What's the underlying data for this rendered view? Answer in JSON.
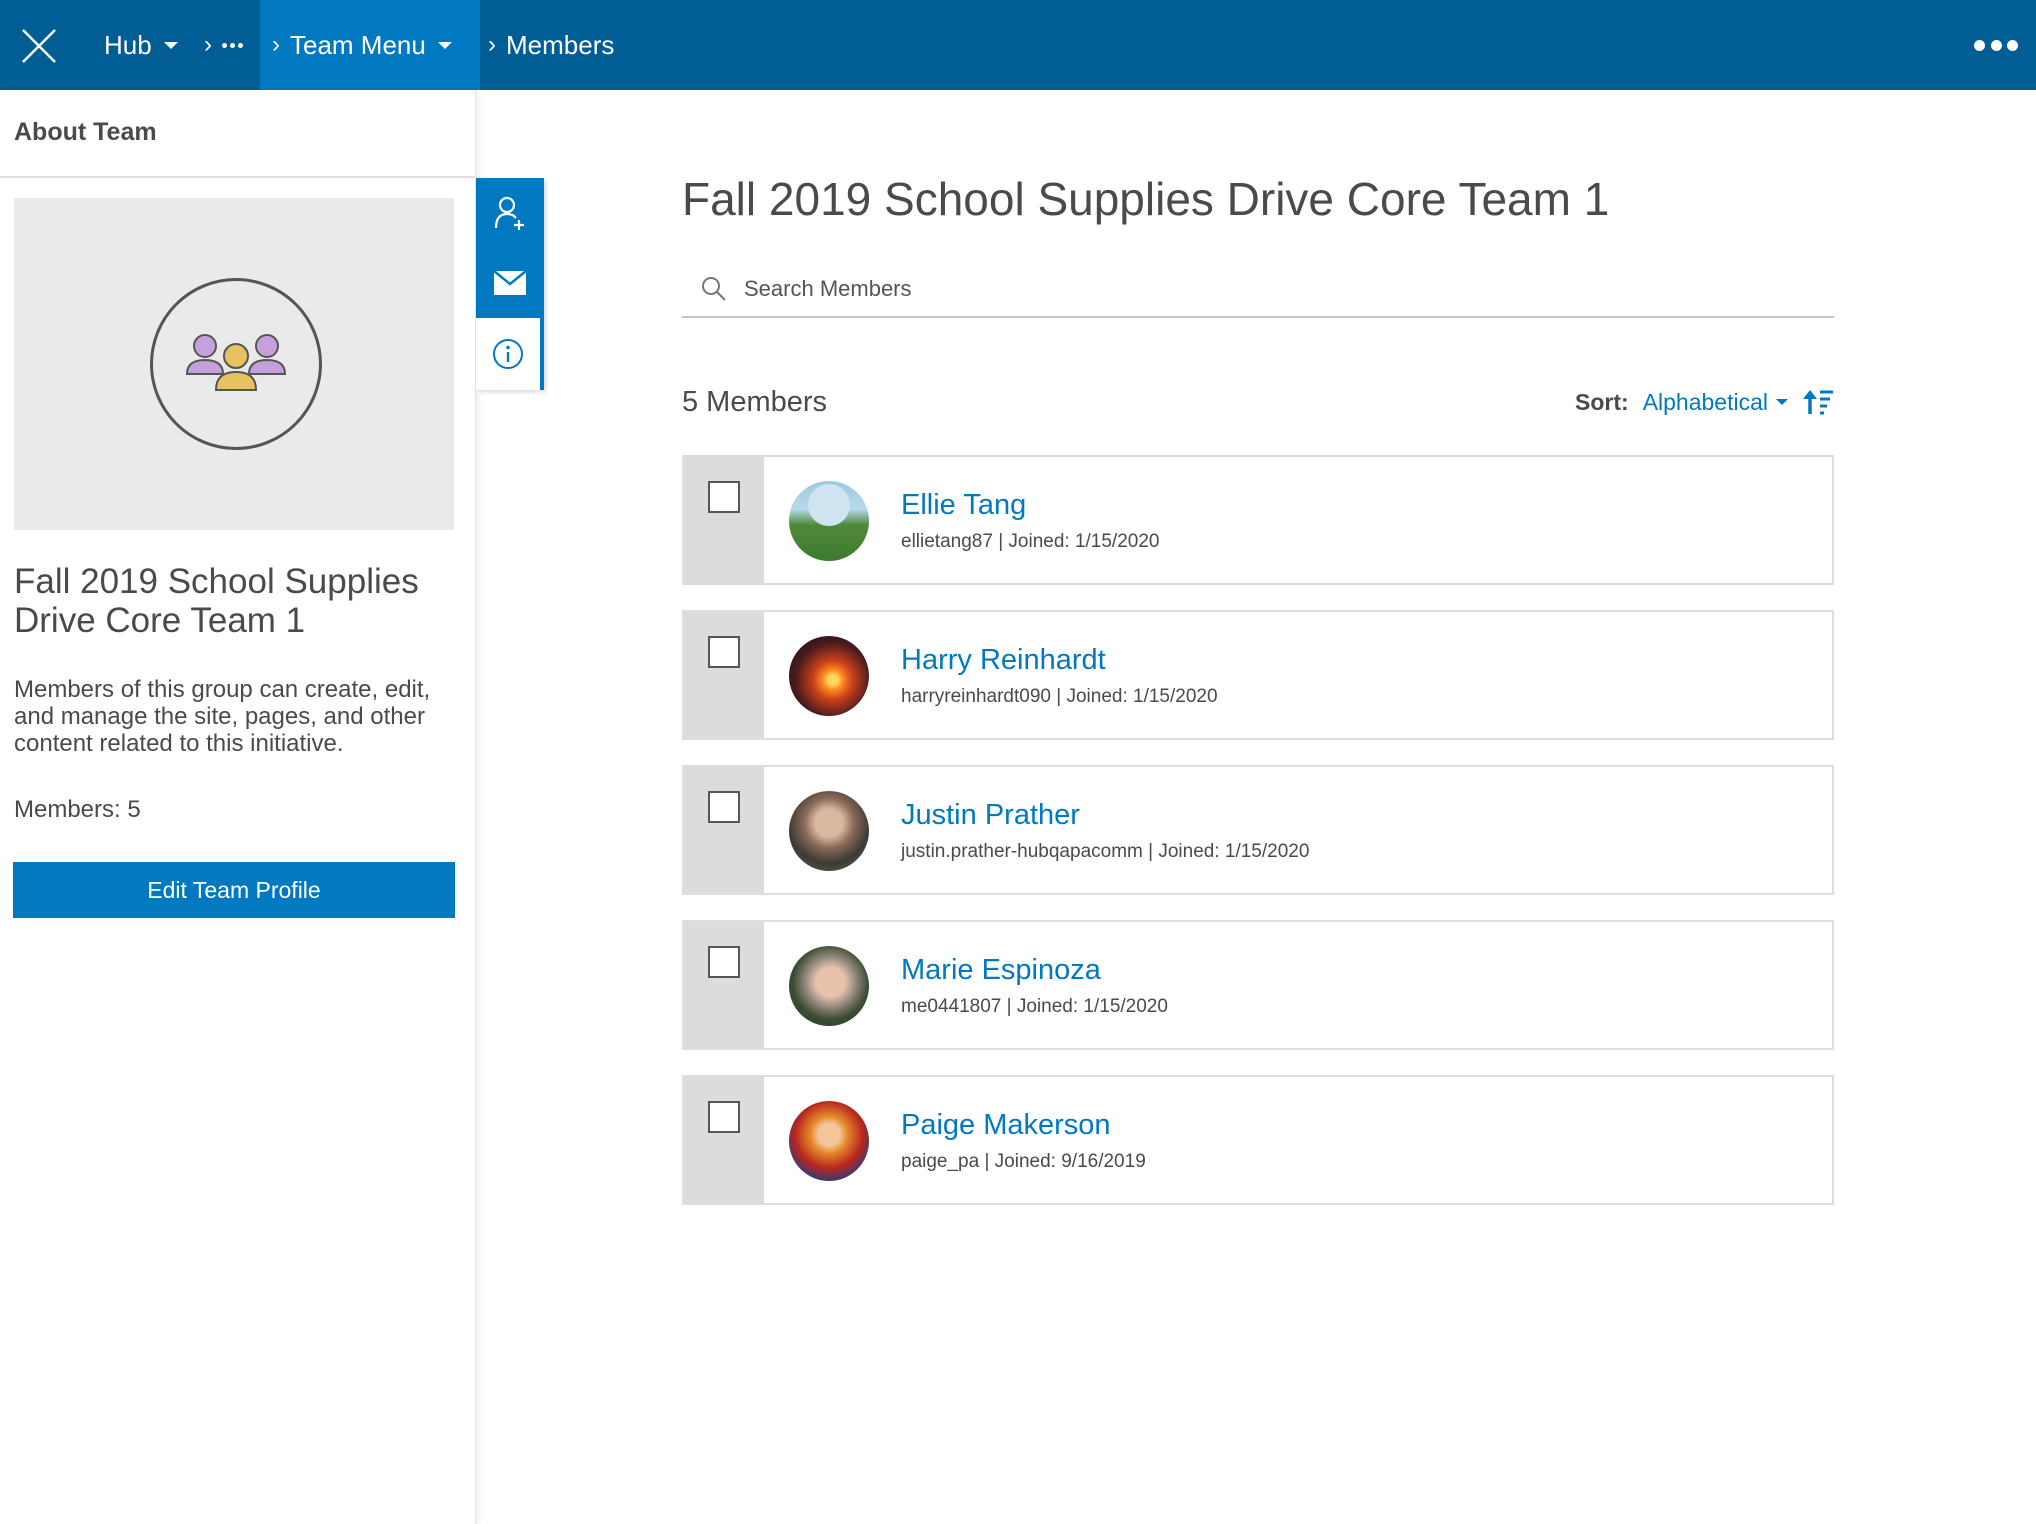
{
  "topbar": {
    "hub_label": "Hub",
    "team_menu_label": "Team Menu",
    "current_label": "Members"
  },
  "sidebar": {
    "header": "About Team",
    "team_title": "Fall 2019 School Supplies Drive Core Team 1",
    "description": "Members of this group can create, edit, and manage the site, pages, and other content related to this initiative.",
    "members_count": "Members: 5",
    "edit_button": "Edit Team Profile"
  },
  "rail": {
    "icons": [
      "add-member-icon",
      "mail-icon",
      "info-icon"
    ]
  },
  "main": {
    "title": "Fall 2019 School Supplies Drive Core Team 1",
    "search_placeholder": "Search Members",
    "members_count": "5 Members",
    "sort_label": "Sort:",
    "sort_value": "Alphabetical"
  },
  "members": [
    {
      "name": "Ellie Tang",
      "meta": "ellietang87 | Joined: 1/15/2020"
    },
    {
      "name": "Harry Reinhardt",
      "meta": "harryreinhardt090 | Joined: 1/15/2020"
    },
    {
      "name": "Justin Prather",
      "meta": "justin.prather-hubqapacomm | Joined: 1/15/2020"
    },
    {
      "name": "Marie Espinoza",
      "meta": "me0441807 | Joined: 1/15/2020"
    },
    {
      "name": "Paige Makerson",
      "meta": "paige_pa | Joined: 9/16/2019"
    }
  ],
  "colors": {
    "topbar": "#005e95",
    "accent": "#0079c1",
    "text": "#4a4a4a"
  }
}
